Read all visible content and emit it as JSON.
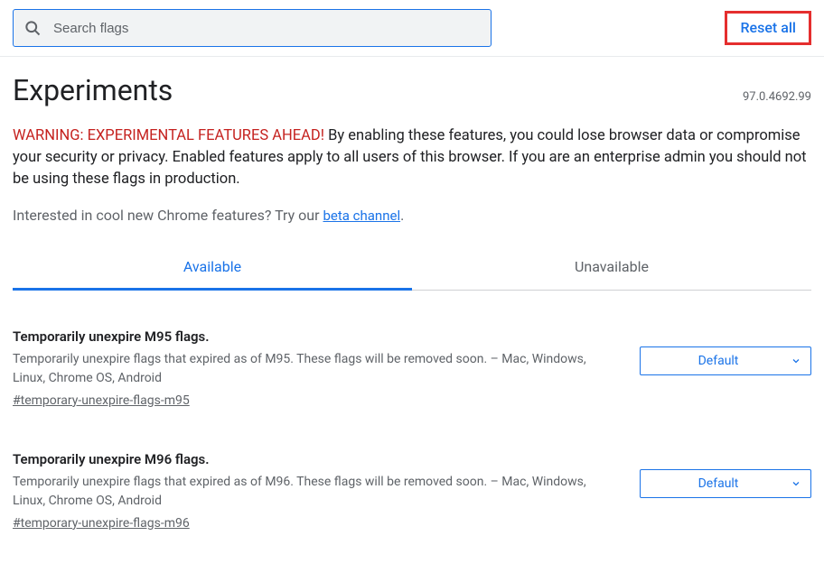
{
  "search": {
    "placeholder": "Search flags"
  },
  "reset": {
    "label": "Reset all"
  },
  "page": {
    "title": "Experiments",
    "version": "97.0.4692.99",
    "warning_prefix": "WARNING: EXPERIMENTAL FEATURES AHEAD!",
    "warning_body": " By enabling these features, you could lose browser data or compromise your security or privacy. Enabled features apply to all users of this browser. If you are an enterprise admin you should not be using these flags in production.",
    "interest_prefix": "Interested in cool new Chrome features? Try our ",
    "interest_link": "beta channel",
    "interest_period": "."
  },
  "tabs": {
    "available": "Available",
    "unavailable": "Unavailable"
  },
  "flags": [
    {
      "title": "Temporarily unexpire M95 flags.",
      "desc": "Temporarily unexpire flags that expired as of M95. These flags will be removed soon. – Mac, Windows, Linux, Chrome OS, Android",
      "anchor": "#temporary-unexpire-flags-m95",
      "select": "Default"
    },
    {
      "title": "Temporarily unexpire M96 flags.",
      "desc": "Temporarily unexpire flags that expired as of M96. These flags will be removed soon. – Mac, Windows, Linux, Chrome OS, Android",
      "anchor": "#temporary-unexpire-flags-m96",
      "select": "Default"
    }
  ]
}
